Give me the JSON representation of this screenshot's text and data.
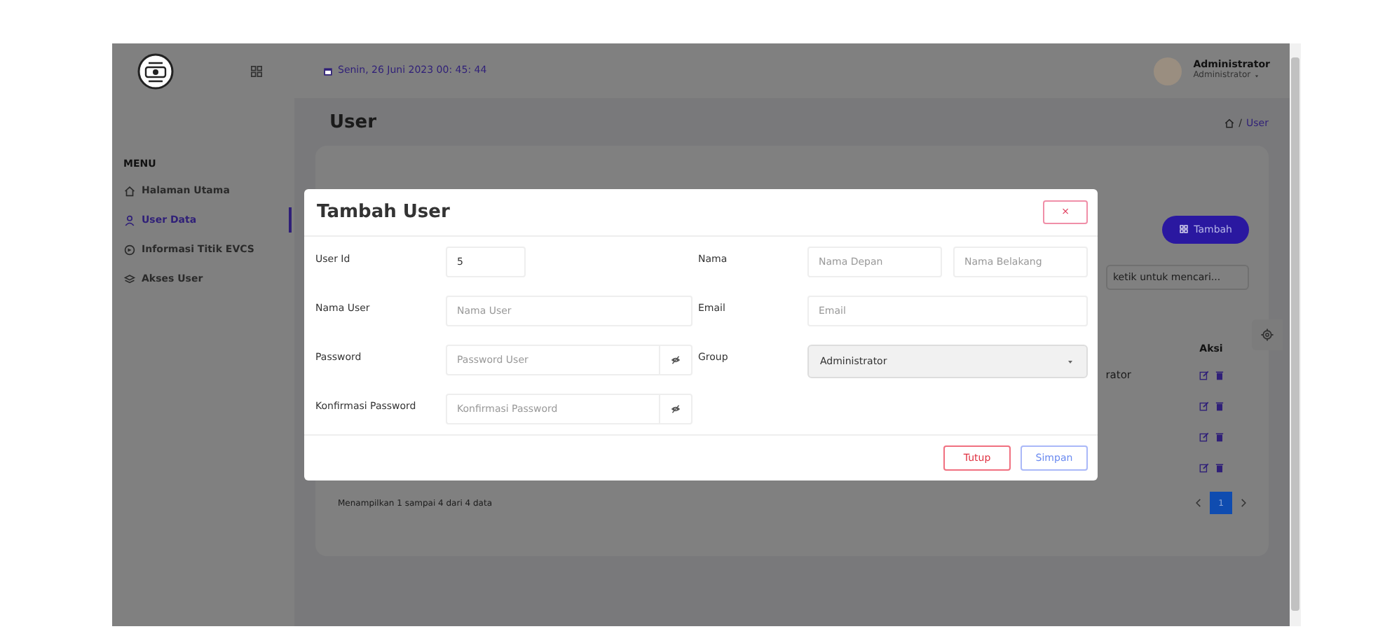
{
  "sidebar": {
    "menu_heading": "MENU",
    "items": [
      {
        "label": "Halaman Utama",
        "selected": false
      },
      {
        "label": "User Data",
        "selected": true
      },
      {
        "label": "Informasi Titik EVCS",
        "selected": false
      },
      {
        "label": "Akses User",
        "selected": false
      }
    ]
  },
  "topbar": {
    "datetime": "Senin, 26 Juni 2023 00: 45: 44",
    "user_name": "Administrator",
    "user_role": "Administrator"
  },
  "page": {
    "title": "User",
    "breadcrumb_separator": "/",
    "breadcrumb": "User"
  },
  "card": {
    "add_button": "Tambah",
    "search_placeholder": "ketik untuk mencari...",
    "column_header": "Aksi",
    "rows": [
      {
        "column_3": "rator"
      },
      {},
      {},
      {}
    ],
    "footer_text": "Menampilkan 1 sampai 4 dari 4 data",
    "pagination": [
      {
        "label": "1",
        "selected": true
      }
    ]
  },
  "modal": {
    "title": "Tambah User",
    "close": "×",
    "left_fields": [
      {
        "label": "User Id",
        "kind": "short",
        "value": "5"
      },
      {
        "label": "Nama User",
        "kind": "text",
        "placeholder": "Nama User"
      },
      {
        "label": "Password",
        "kind": "password",
        "placeholder": "Password User"
      },
      {
        "label": "Konfirmasi Password",
        "kind": "password",
        "placeholder": "Konfirmasi Password"
      }
    ],
    "right_fields": [
      {
        "label": "Nama",
        "kind": "pair",
        "inputs": [
          {
            "placeholder": "Nama Depan"
          },
          {
            "placeholder": "Nama Belakang"
          }
        ]
      },
      {
        "label": "Email",
        "kind": "text",
        "placeholder": "Email"
      },
      {
        "label": "Group",
        "kind": "select",
        "value": "Administrator"
      }
    ],
    "buttons": [
      {
        "label": "Tutup",
        "kind": "danger"
      },
      {
        "label": "Simpan",
        "kind": "primary"
      }
    ]
  }
}
